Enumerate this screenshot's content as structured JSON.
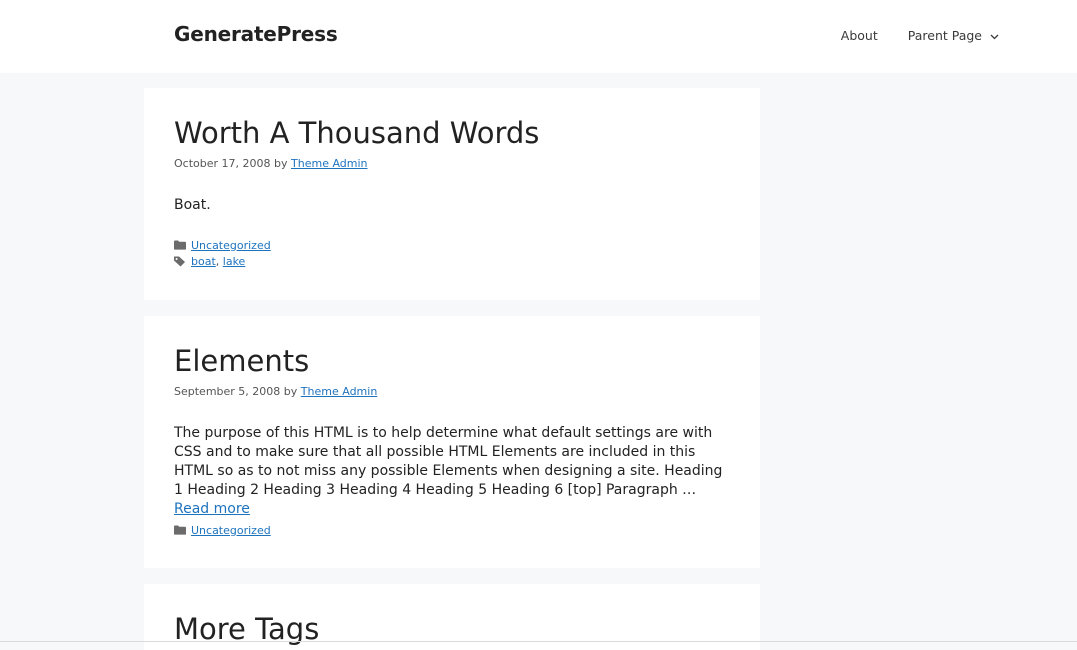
{
  "site": {
    "title": "GeneratePress"
  },
  "nav": {
    "items": [
      {
        "label": "About"
      },
      {
        "label": "Parent Page"
      }
    ]
  },
  "posts": [
    {
      "title": "Worth A Thousand Words",
      "date": "October 17, 2008",
      "by": "by",
      "author": "Theme Admin",
      "excerpt": "Boat.",
      "category": "Uncategorized",
      "tags": [
        "boat",
        "lake"
      ],
      "tag_separator": ","
    },
    {
      "title": "Elements",
      "date": "September 5, 2008",
      "by": "by",
      "author": "Theme Admin",
      "excerpt": "The purpose of this HTML is to help determine what default settings are with CSS and to make sure that all possible HTML Elements are included in this HTML so as to not miss any possible Elements when designing a site. Heading 1 Heading 2 Heading 3 Heading 4 Heading 5 Heading 6 [top] Paragraph …",
      "read_more": "Read more",
      "category": "Uncategorized"
    },
    {
      "title": "More Tags"
    }
  ],
  "colors": {
    "link": "#1e73be",
    "background": "#f7f8f9",
    "card": "#ffffff"
  }
}
